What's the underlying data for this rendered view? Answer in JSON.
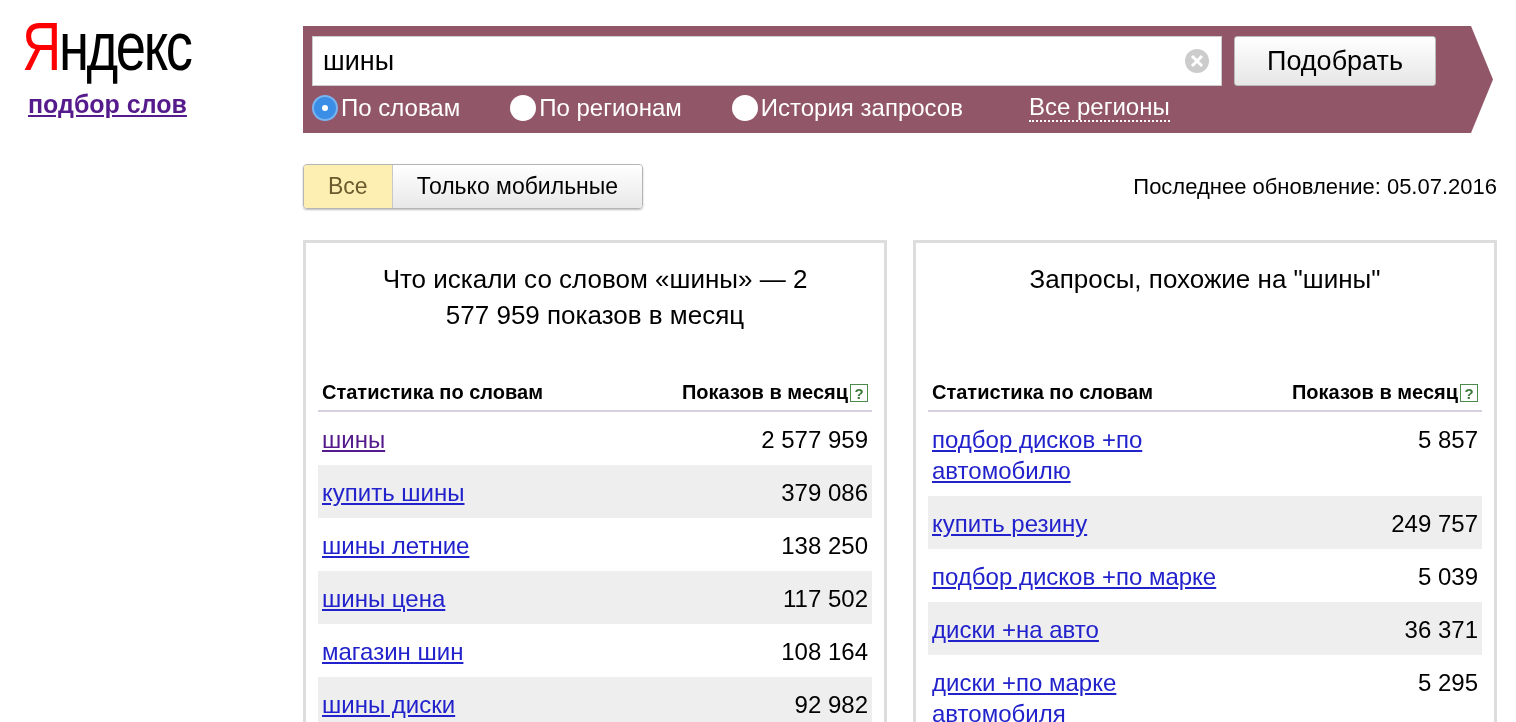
{
  "logo": "Яндекс",
  "service_link": "подбор слов",
  "search": {
    "value": "шины",
    "button": "Подобрать"
  },
  "modes": [
    {
      "label": "По словам",
      "selected": true
    },
    {
      "label": "По регионам",
      "selected": false
    },
    {
      "label": "История запросов",
      "selected": false
    }
  ],
  "region_link": "Все регионы",
  "device_tabs": [
    {
      "label": "Все",
      "selected": true
    },
    {
      "label": "Только мобильные",
      "selected": false
    }
  ],
  "last_update": "Последнее обновление: 05.07.2016",
  "panels": [
    {
      "title": "Что искали со словом «шины» — 2 577 959 показов в месяц",
      "columns": [
        "Статистика по словам",
        "Показов в месяц"
      ],
      "help": "?",
      "rows": [
        {
          "phrase": "шины",
          "count": "2 577 959",
          "visited": true
        },
        {
          "phrase": "купить шины",
          "count": "379 086",
          "visited": false
        },
        {
          "phrase": "шины летние",
          "count": "138 250",
          "visited": false
        },
        {
          "phrase": "шины цена",
          "count": "117 502",
          "visited": false
        },
        {
          "phrase": "магазин шин",
          "count": "108 164",
          "visited": false
        },
        {
          "phrase": "шины диски",
          "count": "92 982",
          "visited": false
        }
      ]
    },
    {
      "title": "Запросы, похожие на \"шины\"",
      "columns": [
        "Статистика по словам",
        "Показов в месяц"
      ],
      "help": "?",
      "rows": [
        {
          "phrase": "подбор дисков +по автомобилю",
          "count": "5 857",
          "visited": false
        },
        {
          "phrase": "купить резину",
          "count": "249 757",
          "visited": false
        },
        {
          "phrase": "подбор дисков +по марке",
          "count": "5 039",
          "visited": false
        },
        {
          "phrase": "диски +на авто",
          "count": "36 371",
          "visited": false
        },
        {
          "phrase": "диски +по марке автомобиля",
          "count": "5 295",
          "visited": false
        }
      ]
    }
  ]
}
